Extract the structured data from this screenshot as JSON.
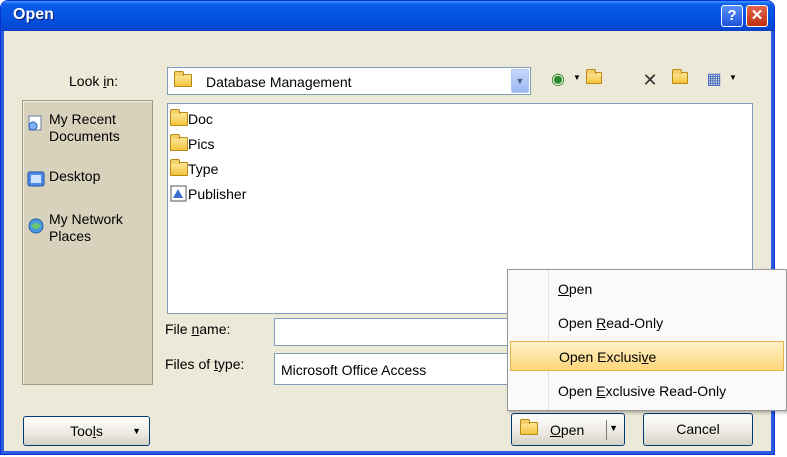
{
  "window": {
    "title": "Open",
    "help_label": "?",
    "close_label": "✕"
  },
  "lookin": {
    "label_pre": "Look ",
    "label_key": "i",
    "label_post": "n:",
    "value": "Database Management"
  },
  "places": [
    {
      "label_line1": "My Recent",
      "label_line2": "Documents",
      "icon": "recent-documents-icon"
    },
    {
      "label_line1": "Desktop",
      "label_line2": "",
      "icon": "desktop-icon"
    },
    {
      "label_line1": "My Network",
      "label_line2": "Places",
      "icon": "network-places-icon"
    }
  ],
  "files": [
    {
      "name": "Doc",
      "icon": "folder-icon"
    },
    {
      "name": "Pics",
      "icon": "folder-icon"
    },
    {
      "name": "Type",
      "icon": "folder-icon"
    },
    {
      "name": "Publisher",
      "icon": "publisher-file-icon"
    }
  ],
  "filename": {
    "label_pre": "File ",
    "label_key": "n",
    "label_post": "ame:",
    "value": ""
  },
  "filetype": {
    "label_pre": "Files of ",
    "label_key": "t",
    "label_post": "ype:",
    "value": "Microsoft Office Access"
  },
  "buttons": {
    "tools_pre": "Too",
    "tools_key": "l",
    "tools_post": "s",
    "open_key": "O",
    "open_post": "pen",
    "cancel": "Cancel"
  },
  "menu": [
    {
      "pre": "",
      "key": "O",
      "post": "pen",
      "highlighted": false
    },
    {
      "pre": "Open ",
      "key": "R",
      "post": "ead-Only",
      "highlighted": false
    },
    {
      "pre": "Open Exclusi",
      "key": "v",
      "post": "e",
      "highlighted": true
    },
    {
      "pre": "Open ",
      "key": "E",
      "post": "xclusive Read-Only",
      "highlighted": false
    }
  ],
  "colors": {
    "titlebar": "#0554e2",
    "dialog_bg": "#ece9d8",
    "menu_highlight": "#ffd57a"
  }
}
